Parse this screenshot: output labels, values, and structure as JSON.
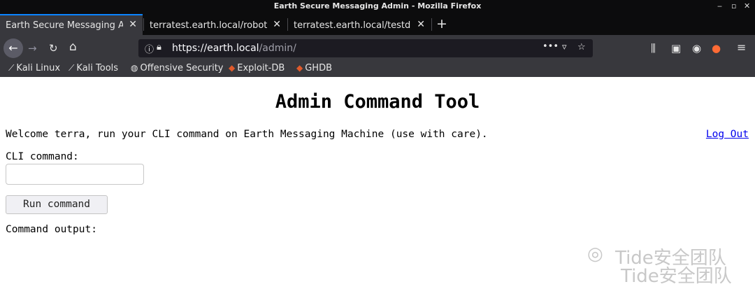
{
  "window": {
    "title": "Earth Secure Messaging Admin - Mozilla Firefox",
    "controls": [
      "‒",
      "▫",
      "✕"
    ]
  },
  "tabs": [
    {
      "label": "Earth Secure Messaging Adm",
      "active": true
    },
    {
      "label": "terratest.earth.local/robots.",
      "active": false
    },
    {
      "label": "terratest.earth.local/testdata",
      "active": false
    }
  ],
  "new_tab_label": "+",
  "nav": {
    "back": "←",
    "forward": "→",
    "reload": "↻",
    "home": "⌂",
    "url_scheme_host": "https://earth.local",
    "url_path": "/admin/",
    "page_actions": "•••"
  },
  "bookmarks": [
    {
      "label": "Kali Linux",
      "icon": "kali-dragon-icon"
    },
    {
      "label": "Kali Tools",
      "icon": "kali-dragon-icon"
    },
    {
      "label": "Offensive Security",
      "icon": "globe-icon"
    },
    {
      "label": "Exploit-DB",
      "icon": "flame-icon"
    },
    {
      "label": "GHDB",
      "icon": "flame-icon"
    }
  ],
  "page": {
    "heading": "Admin Command Tool",
    "welcome": "Welcome terra, run your CLI command on Earth Messaging Machine (use with care).",
    "logout": "Log Out",
    "cli_label": "CLI command:",
    "cli_value": "",
    "run_button": "Run command",
    "output_label": "Command output:"
  },
  "watermark": {
    "line1": "Tide安全团队",
    "line2": "Tide安全团队"
  }
}
